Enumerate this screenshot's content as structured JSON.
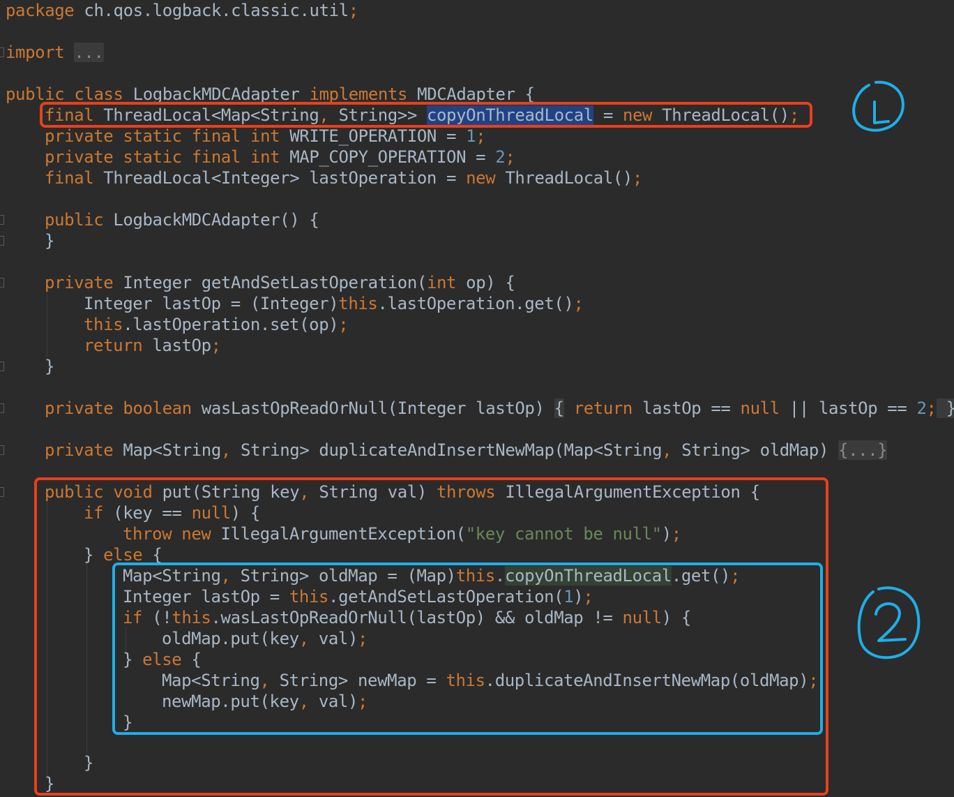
{
  "code": {
    "l1_package_kw": "package",
    "l1_package_name": " ch.qos.logback.classic.util",
    "l1_semi": ";",
    "l2_import_kw": "import",
    "l2_import_fold": "...",
    "l3_public": "public",
    "l3_class": "class",
    "l3_name": "LogbackMDCAdapter",
    "l3_implements": "implements",
    "l3_iface": "MDCAdapter {",
    "l4_final": "final",
    "l4_type_a": " ThreadLocal<Map<String",
    "l4_comma": ",",
    "l4_type_b": " String>> ",
    "l4_field": "copyOnThreadLocal",
    "l4_eq": " = ",
    "l4_new": "new",
    "l4_rhs": " ThreadLocal()",
    "l4_semi": ";",
    "l5_mods": "private static final int",
    "l5_name": " WRITE_OPERATION = ",
    "l5_val": "1",
    "l5_semi": ";",
    "l6_mods": "private static final int",
    "l6_name": " MAP_COPY_OPERATION = ",
    "l6_val": "2",
    "l6_semi": ";",
    "l7_final": "final",
    "l7_type": " ThreadLocal<Integer> lastOperation = ",
    "l7_new": "new",
    "l7_rhs": " ThreadLocal()",
    "l7_semi": ";",
    "l8_public": "public",
    "l8_sig": " LogbackMDCAdapter() {",
    "l9_close": "}",
    "l10_private": "private",
    "l10_sig_a": " Integer getAndSetLastOperation(",
    "l10_int": "int",
    "l10_sig_b": " op) {",
    "l11_a": "Integer lastOp = (Integer)",
    "l11_this": "this",
    "l11_b": ".lastOperation.get()",
    "l11_semi": ";",
    "l12_this": "this",
    "l12_b": ".lastOperation.set(op)",
    "l12_semi": ";",
    "l13_return": "return",
    "l13_b": " lastOp",
    "l13_semi": ";",
    "l14_close": "}",
    "l15_mods": "private boolean",
    "l15_sig": " wasLastOpReadOrNull(Integer lastOp) ",
    "l15_ob": "{",
    "l15_return": " return",
    "l15_a": " lastOp == ",
    "l15_null": "null",
    "l15_b": " || lastOp == ",
    "l15_val": "2",
    "l15_semi": ";",
    "l15_cb": " }",
    "l16_private": "private",
    "l16_a": " Map<String",
    "l16_c1": ",",
    "l16_b": " String> duplicateAndInsertNewMap(Map<String",
    "l16_c2": ",",
    "l16_c": " String> oldMap) ",
    "l16_fold": "{...}",
    "l17_mods": "public void",
    "l17_a": " put(String key",
    "l17_comma": ",",
    "l17_b": " String val) ",
    "l17_throws": "throws",
    "l17_c": " IllegalArgumentException {",
    "l18_if": "if",
    "l18_a": " (key == ",
    "l18_null": "null",
    "l18_b": ") {",
    "l19_throw": "throw new",
    "l19_a": " IllegalArgumentException(",
    "l19_str": "\"key cannot be null\"",
    "l19_b": ")",
    "l19_semi": ";",
    "l20_a": "} ",
    "l20_else": "else",
    "l20_b": " {",
    "l21_a": "Map<String",
    "l21_comma": ",",
    "l21_b": " String> oldMap = (Map)",
    "l21_this": "this",
    "l21_dot": ".",
    "l21_field": "copyOnThreadLocal",
    "l21_c": ".get()",
    "l21_semi": ";",
    "l22_a": "Integer lastOp = ",
    "l22_this": "this",
    "l22_b": ".getAndSetLastOperation(",
    "l22_val": "1",
    "l22_c": ")",
    "l22_semi": ";",
    "l23_if": "if",
    "l23_a": " (!",
    "l23_this": "this",
    "l23_b": ".wasLastOpReadOrNull(lastOp) && oldMap != ",
    "l23_null": "null",
    "l23_c": ") {",
    "l24_a": "oldMap.put(key",
    "l24_comma": ",",
    "l24_b": " val)",
    "l24_semi": ";",
    "l25_a": "} ",
    "l25_else": "else",
    "l25_b": " {",
    "l26_a": "Map<String",
    "l26_comma": ",",
    "l26_b": " String> newMap = ",
    "l26_this": "this",
    "l26_c": ".duplicateAndInsertNewMap(oldMap)",
    "l26_semi": ";",
    "l27_a": "newMap.put(key",
    "l27_comma": ",",
    "l27_b": " val)",
    "l27_semi": ";",
    "l28_close": "}",
    "l29_close": "}",
    "l30_close": "}"
  },
  "annotations": {
    "circle_1": "1",
    "circle_2": "2"
  },
  "colors": {
    "background": "#2b2b2b",
    "keyword": "#cc7832",
    "number": "#6897bb",
    "string": "#6a8759",
    "default_text": "#a9b7c6",
    "selection": "#214283",
    "red_box": "#e8401c",
    "blue_box": "#1eaee8"
  }
}
